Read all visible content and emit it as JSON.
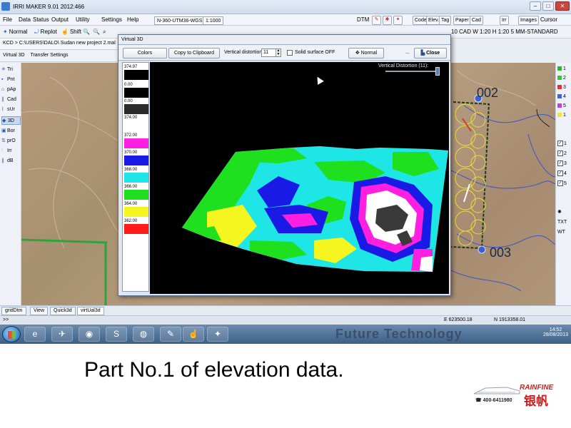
{
  "window": {
    "title": "IRRI MAKER  9.01  2012:466",
    "controls": [
      "–",
      "□",
      "✕"
    ]
  },
  "menubar": {
    "items": [
      "File",
      "Data",
      "Status",
      "Output",
      "Utility",
      "Settings",
      "Help"
    ],
    "projection": "N-360-UTM36-WGS",
    "scale": "1:1000",
    "right_items": [
      "DTM",
      "Code",
      "Elev.",
      "Tag",
      "Paper",
      "Cad",
      "Irr",
      "Images",
      "Cursor"
    ]
  },
  "toolbar2": {
    "items": [
      "Normal",
      "Replot",
      "Shift"
    ],
    "hidden_row": "10 CAD  W 1:20  H 1:20  5  MM-STANDARD"
  },
  "pathbar": {
    "text": "KCD > C:\\USERS\\DALO\\ Sudan new project 2.mal"
  },
  "menubar3": {
    "items": [
      "Virtual 3D",
      "Transfer Settings"
    ]
  },
  "left_tools": [
    {
      "icon": "tri-icon",
      "label": "Tri"
    },
    {
      "icon": "point-icon",
      "label": "Pnt"
    },
    {
      "icon": "pap-icon",
      "label": "pAp"
    },
    {
      "icon": "cad-icon",
      "label": "Cad"
    },
    {
      "icon": "sur-icon",
      "label": "sUr"
    },
    {
      "icon": "3d-icon",
      "label": "3D"
    },
    {
      "icon": "border-icon",
      "label": "Bor"
    },
    {
      "icon": "profile-icon",
      "label": "prO"
    },
    {
      "icon": "irrigation-icon",
      "label": "Irr"
    },
    {
      "icon": "db-icon",
      "label": "dB"
    }
  ],
  "map_labels": [
    "002",
    "003"
  ],
  "right_tools": {
    "swatches": [
      {
        "n": "1",
        "color": "#2bb52b"
      },
      {
        "n": "2",
        "color": "#39c43d"
      },
      {
        "n": "3",
        "color": "#e13434"
      },
      {
        "n": "4",
        "color": "#3c64d8"
      },
      {
        "n": "5",
        "color": "#c53be0"
      },
      {
        "n": "1",
        "color": "#f2e53a"
      }
    ],
    "checks": [
      "1",
      "2",
      "3",
      "4",
      "5"
    ],
    "extras": [
      "TXT",
      "WT"
    ]
  },
  "dialog": {
    "title": "Virtual 3D",
    "colors_button": "Colors",
    "copy_button": "Copy to Clipboard",
    "vd_label": "Vertical distortion",
    "vd_value": "11",
    "solid_label": "Solid surface OFF",
    "normal_button": "Normal",
    "close_button": "Close",
    "distortion_readout": "Vertical Distortion (11):",
    "legend": [
      {
        "value": "374.97",
        "color": "#000000"
      },
      {
        "value": "0.00",
        "color": "#000000"
      },
      {
        "value": "0.00",
        "color": "#2b2b2b"
      },
      {
        "value": "374.00",
        "color": "#ffffff"
      },
      {
        "value": "372.00",
        "color": "#ff1fe0"
      },
      {
        "value": "370.00",
        "color": "#1a1ae6"
      },
      {
        "value": "368.00",
        "color": "#1fe6e6"
      },
      {
        "value": "366.00",
        "color": "#1fe01f"
      },
      {
        "value": "364.00",
        "color": "#f5f51f"
      },
      {
        "value": "362.00",
        "color": "#ff1a1a"
      }
    ]
  },
  "tabs": [
    "gridDtm",
    "View",
    "Quick3d",
    "virtUal3d"
  ],
  "status": {
    "easting": "E 623500.18",
    "northing": "N 1913358.01"
  },
  "taskbar": {
    "banner": "Future Technology",
    "time": "14:52",
    "date": "28/08/2013",
    "apps": [
      "ie-icon",
      "app-icon",
      "chrome-icon",
      "skype-icon",
      "earth-icon",
      "pdf-icon",
      "hand-icon",
      "irri-icon"
    ]
  },
  "caption": "Part No.1 of elevation data.",
  "logo": {
    "brand": "RAINFINE",
    "cn": "银帆",
    "phone": "☎ 400-6411980"
  }
}
